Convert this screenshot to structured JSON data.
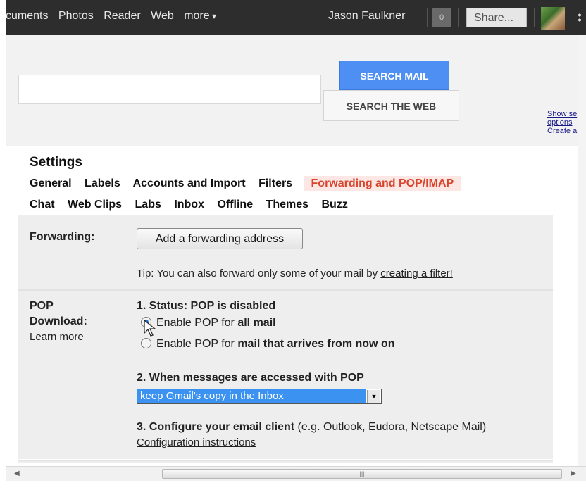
{
  "topbar": {
    "nav": [
      "cuments",
      "Photos",
      "Reader",
      "Web",
      "more"
    ],
    "user": "Jason Faulkner",
    "count": "0",
    "share": "Share..."
  },
  "search": {
    "search_mail": "SEARCH MAIL",
    "search_web": "SEARCH THE WEB",
    "side_links": [
      "Show se",
      "options",
      "Create a"
    ]
  },
  "settings": {
    "title": "Settings",
    "tabs_row1": [
      "General",
      "Labels",
      "Accounts and Import",
      "Filters",
      "Forwarding and POP/IMAP"
    ],
    "tabs_row2": [
      "Chat",
      "Web Clips",
      "Labs",
      "Inbox",
      "Offline",
      "Themes",
      "Buzz"
    ],
    "active_tab": "Forwarding and POP/IMAP"
  },
  "forwarding": {
    "label": "Forwarding:",
    "button": "Add a forwarding address",
    "tip": "Tip: You can also forward only some of your mail by ",
    "tip_link": "creating a filter!"
  },
  "pop": {
    "label_line1": "POP",
    "label_line2": "Download:",
    "learn_more": "Learn more",
    "status": "1. Status: POP is disabled",
    "option1_prefix": "Enable POP for ",
    "option1_bold": "all mail",
    "option2_prefix": "Enable POP for ",
    "option2_bold": "mail that arrives from now on",
    "access_heading": "2. When messages are accessed with POP",
    "access_selected": "keep Gmail's copy in the Inbox",
    "configure_heading": "3. Configure your email client",
    "configure_note": " (e.g. Outlook, Eudora, Netscape Mail)",
    "config_link": "Configuration instructions"
  },
  "colors": {
    "topbar_bg": "#2d2d2d",
    "search_mail_btn": "#4d8ff3",
    "active_tab_text": "#d6452c",
    "active_tab_bg": "#fde7e4",
    "selected_option_bg": "#3b92f0"
  }
}
